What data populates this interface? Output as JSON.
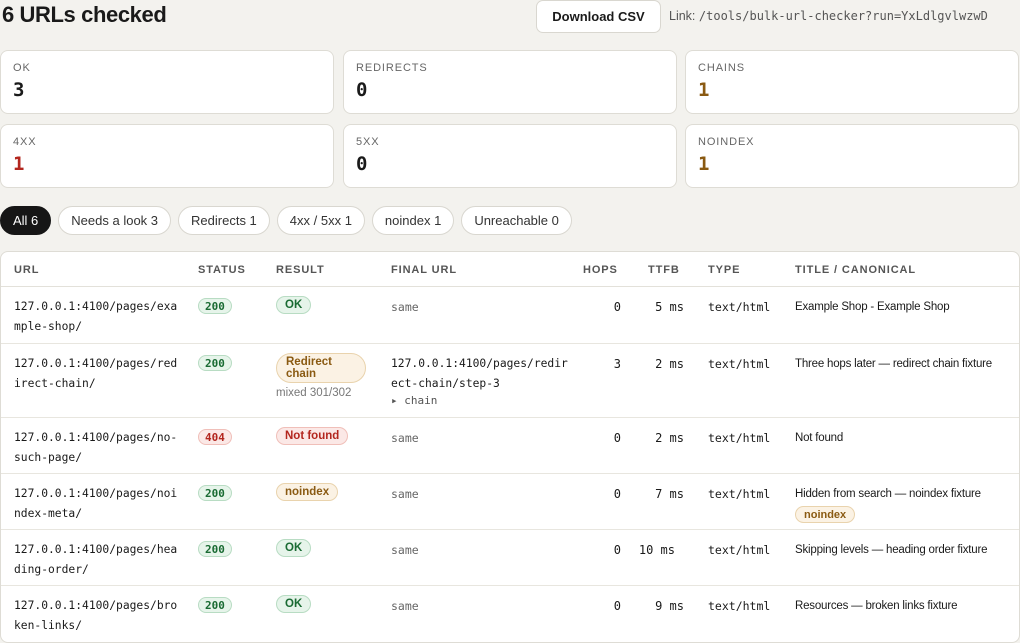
{
  "header": {
    "title": "6 URLs checked",
    "download_label": "Download CSV",
    "link_label": "Link:",
    "link_url": "/tools/bulk-url-checker?run=YxLdlgvlwzwD"
  },
  "stats": [
    {
      "label": "OK",
      "value": "3",
      "color": "#1a1a1a"
    },
    {
      "label": "REDIRECTS",
      "value": "0",
      "color": "#1a1a1a"
    },
    {
      "label": "CHAINS",
      "value": "1",
      "color": "#8a5a12"
    },
    {
      "label": "4XX",
      "value": "1",
      "color": "#b3261e"
    },
    {
      "label": "5XX",
      "value": "0",
      "color": "#1a1a1a"
    },
    {
      "label": "NOINDEX",
      "value": "1",
      "color": "#8a5a12"
    }
  ],
  "filters": [
    {
      "label": "All 6",
      "active": true
    },
    {
      "label": "Needs a look 3",
      "active": false
    },
    {
      "label": "Redirects 1",
      "active": false
    },
    {
      "label": "4xx / 5xx 1",
      "active": false
    },
    {
      "label": "noindex 1",
      "active": false
    },
    {
      "label": "Unreachable 0",
      "active": false
    }
  ],
  "table": {
    "columns": [
      "URL",
      "STATUS",
      "RESULT",
      "FINAL URL",
      "HOPS",
      "TTFB",
      "TYPE",
      "TITLE / CANONICAL"
    ],
    "rows": [
      {
        "url": "127.0.0.1:4100/pages/example-shop/",
        "status": "200",
        "result": "OK",
        "final_url": "same",
        "hops": "0",
        "ttfb": "5 ms",
        "type": "text/html",
        "title": "Example Shop - Example Shop"
      },
      {
        "url": "127.0.0.1:4100/pages/redirect-chain/",
        "status": "200",
        "result": "Redirect chain",
        "result_sub": "mixed 301/302",
        "final_url": "127.0.0.1:4100/pages/redirect-chain/step-3",
        "chain_toggle": "▸ chain",
        "hops": "3",
        "ttfb": "2 ms",
        "type": "text/html",
        "title": "Three hops later — redirect chain fixture"
      },
      {
        "url": "127.0.0.1:4100/pages/no-such-page/",
        "status": "404",
        "result": "Not found",
        "final_url": "same",
        "hops": "0",
        "ttfb": "2 ms",
        "type": "text/html",
        "title": "Not found"
      },
      {
        "url": "127.0.0.1:4100/pages/noindex-meta/",
        "status": "200",
        "result": "noindex",
        "final_url": "same",
        "hops": "0",
        "ttfb": "7 ms",
        "type": "text/html",
        "title": "Hidden from search — noindex fixture",
        "title_badge": "noindex"
      },
      {
        "url": "127.0.0.1:4100/pages/heading-order/",
        "status": "200",
        "result": "OK",
        "final_url": "same",
        "hops": "0",
        "ttfb": "10 ms",
        "type": "text/html",
        "title": "Skipping levels — heading order fixture"
      },
      {
        "url": "127.0.0.1:4100/pages/broken-links/",
        "status": "200",
        "result": "OK",
        "final_url": "same",
        "hops": "0",
        "ttfb": "9 ms",
        "type": "text/html",
        "title": "Resources — broken links fixture"
      }
    ]
  }
}
